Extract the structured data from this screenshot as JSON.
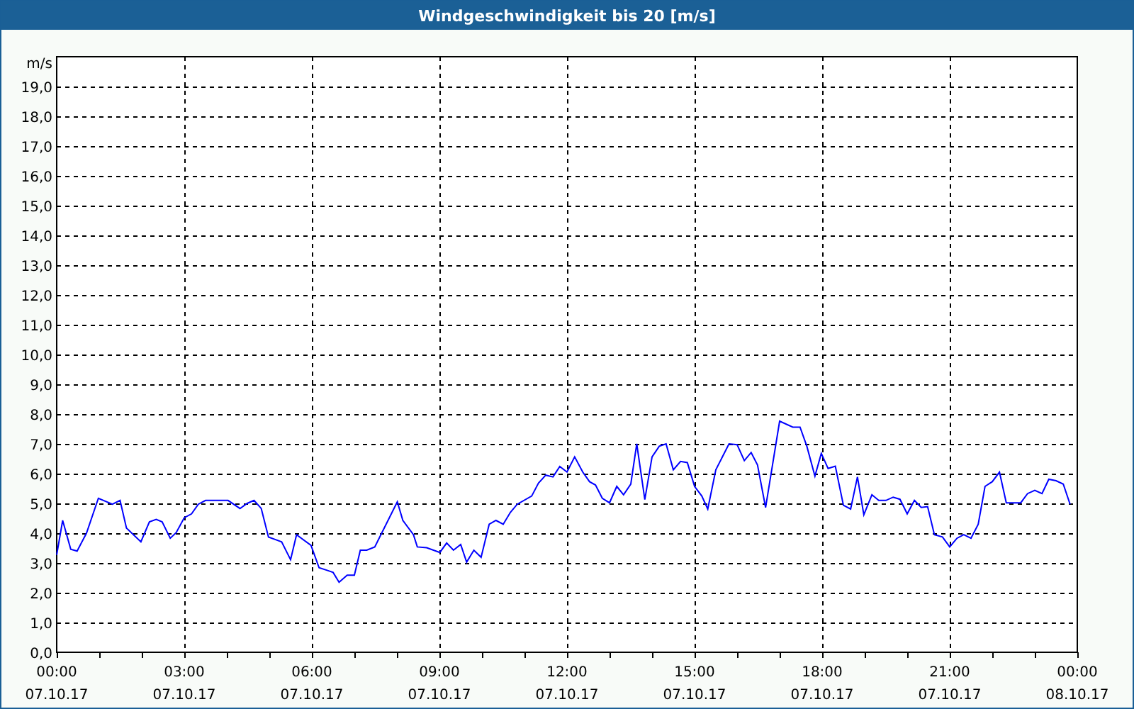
{
  "window": {
    "title": "Windgeschwindigkeit bis 20 [m/s]"
  },
  "chart": {
    "chart_data": {
      "type": "line",
      "grid": true,
      "ylabel": "m/s",
      "xlim": [
        0,
        24
      ],
      "ylim": [
        0,
        20
      ],
      "x": [
        0,
        0.14,
        0.33,
        0.48,
        0.7,
        0.98,
        1.31,
        1.49,
        1.64,
        1.98,
        2.18,
        2.34,
        2.48,
        2.67,
        2.81,
        3.0,
        3.17,
        3.33,
        3.5,
        4.03,
        4.31,
        4.48,
        4.64,
        4.81,
        4.98,
        5.29,
        5.5,
        5.64,
        5.98,
        6.17,
        6.37,
        6.5,
        6.64,
        6.83,
        7.0,
        7.14,
        7.29,
        7.48,
        8.01,
        8.14,
        8.39,
        8.48,
        8.7,
        9.01,
        9.17,
        9.33,
        9.5,
        9.64,
        9.81,
        9.98,
        10.17,
        10.33,
        10.5,
        10.67,
        10.83,
        11.17,
        11.33,
        11.5,
        11.67,
        11.83,
        12.0,
        12.18,
        12.37,
        12.53,
        12.67,
        12.83,
        13.0,
        13.17,
        13.33,
        13.5,
        13.64,
        13.83,
        14.0,
        14.17,
        14.33,
        14.5,
        14.67,
        14.83,
        15.0,
        15.17,
        15.31,
        15.5,
        15.81,
        16.0,
        16.17,
        16.33,
        16.48,
        16.67,
        17.0,
        17.31,
        17.48,
        17.64,
        17.83,
        17.98,
        18.14,
        18.31,
        18.5,
        18.67,
        18.83,
        18.98,
        19.17,
        19.33,
        19.5,
        19.67,
        19.83,
        20.0,
        20.17,
        20.33,
        20.48,
        20.64,
        20.83,
        21.0,
        21.17,
        21.33,
        21.5,
        21.67,
        21.83,
        22.0,
        22.17,
        22.33,
        22.67,
        22.83,
        23.0,
        23.17,
        23.33,
        23.5,
        23.67,
        23.83
      ],
      "series": [
        {
          "color": "#0000ff",
          "values": [
            3.27,
            4.43,
            3.46,
            3.4,
            4.0,
            5.17,
            4.97,
            5.1,
            4.17,
            3.71,
            4.38,
            4.46,
            4.38,
            3.83,
            4.02,
            4.52,
            4.65,
            4.97,
            5.1,
            5.1,
            4.83,
            5.0,
            5.1,
            4.83,
            3.87,
            3.71,
            3.11,
            3.95,
            3.59,
            2.84,
            2.75,
            2.68,
            2.35,
            2.59,
            2.59,
            3.43,
            3.43,
            3.54,
            5.05,
            4.43,
            3.95,
            3.54,
            3.51,
            3.35,
            3.67,
            3.43,
            3.62,
            3.03,
            3.43,
            3.19,
            4.3,
            4.43,
            4.3,
            4.7,
            4.97,
            5.25,
            5.68,
            5.95,
            5.89,
            6.24,
            6.05,
            6.56,
            6.05,
            5.73,
            5.62,
            5.17,
            5.02,
            5.57,
            5.29,
            5.65,
            7.0,
            5.13,
            6.56,
            6.92,
            7.0,
            6.13,
            6.41,
            6.37,
            5.57,
            5.25,
            4.81,
            6.13,
            7.0,
            6.97,
            6.44,
            6.71,
            6.29,
            4.86,
            7.76,
            7.56,
            7.56,
            6.92,
            5.92,
            6.68,
            6.17,
            6.25,
            4.94,
            4.81,
            5.89,
            4.62,
            5.29,
            5.1,
            5.1,
            5.21,
            5.14,
            4.65,
            5.1,
            4.86,
            4.89,
            3.95,
            3.87,
            3.54,
            3.83,
            3.95,
            3.83,
            4.3,
            5.57,
            5.73,
            6.05,
            5.02,
            5.02,
            5.33,
            5.44,
            5.33,
            5.81,
            5.76,
            5.65,
            4.97
          ]
        }
      ],
      "xticks": [
        {
          "value": 0,
          "label": "00:00"
        },
        {
          "value": 3,
          "label": "03:00"
        },
        {
          "value": 6,
          "label": "06:00"
        },
        {
          "value": 9,
          "label": "09:00"
        },
        {
          "value": 12,
          "label": "12:00"
        },
        {
          "value": 15,
          "label": "15:00"
        },
        {
          "value": 18,
          "label": "18:00"
        },
        {
          "value": 21,
          "label": "21:00"
        },
        {
          "value": 24,
          "label": "00:00"
        }
      ],
      "yticks": [
        {
          "value": 0,
          "label": "0,0"
        },
        {
          "value": 1,
          "label": "1,0"
        },
        {
          "value": 2,
          "label": "2,0"
        },
        {
          "value": 3,
          "label": "3,0"
        },
        {
          "value": 4,
          "label": "4,0"
        },
        {
          "value": 5,
          "label": "5,0"
        },
        {
          "value": 6,
          "label": "6,0"
        },
        {
          "value": 7,
          "label": "7,0"
        },
        {
          "value": 8,
          "label": "8,0"
        },
        {
          "value": 9,
          "label": "9,0"
        },
        {
          "value": 10,
          "label": "10,0"
        },
        {
          "value": 11,
          "label": "11,0"
        },
        {
          "value": 12,
          "label": "12,0"
        },
        {
          "value": 13,
          "label": "13,0"
        },
        {
          "value": 14,
          "label": "14,0"
        },
        {
          "value": 15,
          "label": "15,0"
        },
        {
          "value": 16,
          "label": "16,0"
        },
        {
          "value": 17,
          "label": "17,0"
        },
        {
          "value": 18,
          "label": "18,0"
        },
        {
          "value": 19,
          "label": "19,0"
        }
      ]
    },
    "x_tick_dates": [
      "07.10.17",
      "07.10.17",
      "07.10.17",
      "07.10.17",
      "07.10.17",
      "07.10.17",
      "07.10.17",
      "07.10.17",
      "08.10.17"
    ]
  }
}
